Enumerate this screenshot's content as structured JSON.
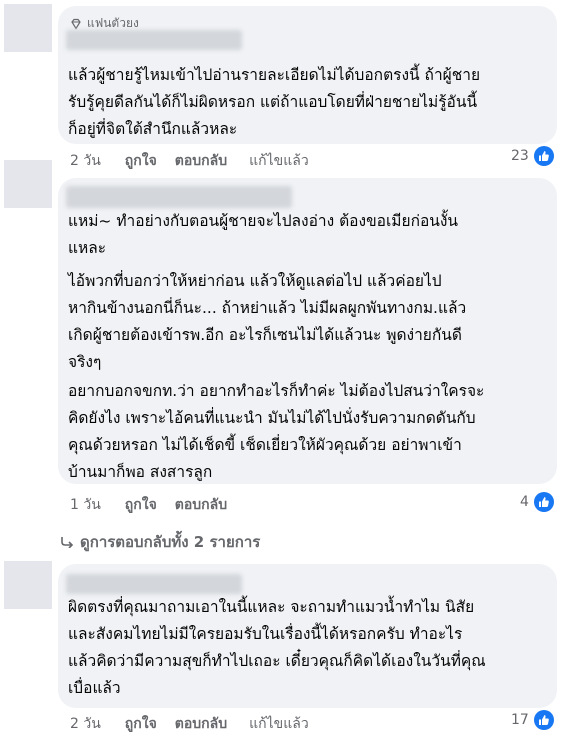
{
  "colors": {
    "bubble": "#f0f2f5",
    "meta": "#65676b",
    "like": "#1877f2"
  },
  "badge": {
    "icon": "diamond-icon",
    "label": "แฟนตัวยง"
  },
  "comments": [
    {
      "paragraphs": [
        "แล้วผู้ชายรู้ไหมเข้าไปอ่านรายละเอียดไม่ได้บอกตรงนี้ ถ้าผู้ชาย\nรับรู้คุยดีลกันได้ก็ไม่ผิดหรอก แต่ถ้าแอบโดยที่ฝ่ายชายไม่รู้อันนี้\nก็อยู่ที่จิตใต้สำนึกแล้วหละ"
      ],
      "time": "2 วัน",
      "like": "ถูกใจ",
      "reply": "ตอบกลับ",
      "edited": "แก้ไขแล้ว",
      "reactions": "23"
    },
    {
      "paragraphs": [
        "แหม่~  ทำอย่างกับตอนผู้ชายจะไปลงอ่าง ต้องขอเมียก่อนงั้น\nแหละ",
        "ไอ้พวกที่บอกว่าให้หย่าก่อน แล้วให้ดูแลต่อไป แล้วค่อยไป\nหากินข้างนอกนี่ก็นะ... ถ้าหย่าแล้ว ไม่มีผลผูกพันทางกม.แล้ว\nเกิดผู้ชายต้องเข้ารพ.อีก อะไรก็เซนไม่ได้แล้วนะ พูดง่ายกันดี\nจริงๆ",
        "อยากบอกจขกท.ว่า อยากทำอะไรก็ทำค่ะ ไม่ต้องไปสนว่าใครจะ\nคิดยังไง เพราะไอ้คนที่แนะนำ มันไม่ได้ไปนั่งรับความกดดันกับ\nคุณด้วยหรอก ไม่ได้เช็ดขี้ เช็ดเยี่ยวให้ผัวคุณด้วย อย่าพาเข้า\nบ้านมาก็พอ สงสารลูก"
      ],
      "time": "1 วัน",
      "like": "ถูกใจ",
      "reply": "ตอบกลับ",
      "edited": "",
      "reactions": "4"
    },
    {
      "paragraphs": [
        "ผิดตรงที่คุณมาถามเอาในนี้แหละ จะถามทำแมวน้ำทำไม นิสัย\nและสังคมไทยไม่มีใครยอมรับในเรื่องนี้ได้หรอกครับ ทำอะไร\nแล้วคิดว่ามีความสุขก็ทำไปเถอะ เดี๋ยวคุณก็คิดได้เองในวันที่คุณ\nเบื่อแล้ว"
      ],
      "time": "2 วัน",
      "like": "ถูกใจ",
      "reply": "ตอบกลับ",
      "edited": "แก้ไขแล้ว",
      "reactions": "17"
    }
  ],
  "view_replies": "ดูการตอบกลับทั้ง 2 รายการ"
}
